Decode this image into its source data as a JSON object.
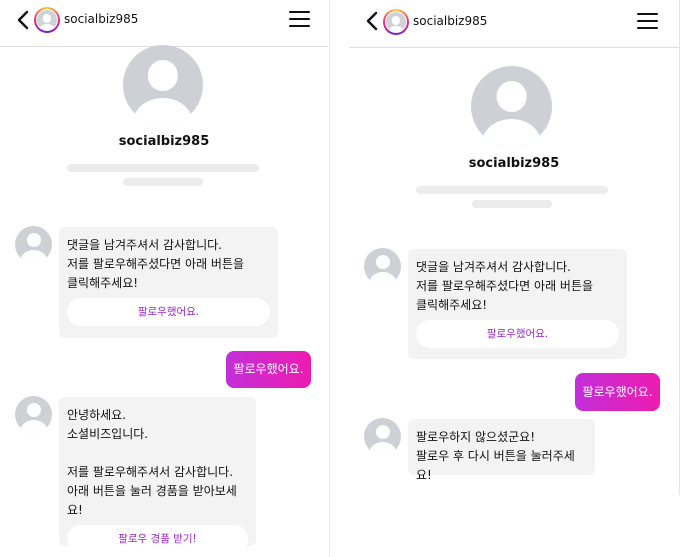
{
  "left": {
    "header": {
      "username": "socialbiz985"
    },
    "profile": {
      "name": "socialbiz985"
    },
    "messages": [
      {
        "type": "received",
        "text": "댓글을 남겨주셔서 감사합니다.\n저를 팔로우해주셨다면 아래 버튼을\n클릭해주세요!",
        "button": "팔로우했어요."
      },
      {
        "type": "sent",
        "text": "팔로우했어요."
      },
      {
        "type": "received",
        "text": "안녕하세요.\n소셜비즈입니다.\n\n저를 팔로우해주셔서 감사합니다.\n아래 버튼을 눌러 경품을 받아보세요!",
        "button": "팔로우 경품 받기!"
      }
    ]
  },
  "right": {
    "header": {
      "username": "socialbiz985"
    },
    "profile": {
      "name": "socialbiz985"
    },
    "messages": [
      {
        "type": "received",
        "text": "댓글을 남겨주셔서 감사합니다.\n저를 팔로우해주셨다면 아래 버튼을\n클릭해주세요!",
        "button": "팔로우했어요."
      },
      {
        "type": "sent",
        "text": "팔로우했어요."
      },
      {
        "type": "received",
        "text": "팔로우하지 않으셨군요!\n팔로우 후 다시 버튼을 눌러주세요!"
      }
    ]
  },
  "colors": {
    "accent_start": "#c22fd9",
    "accent_end": "#ee1bb0",
    "pill_text": "#9b27c9",
    "bubble_bg": "#f3f3f3"
  },
  "icons": [
    "back-chevron-icon",
    "menu-icon",
    "avatar-icon"
  ]
}
